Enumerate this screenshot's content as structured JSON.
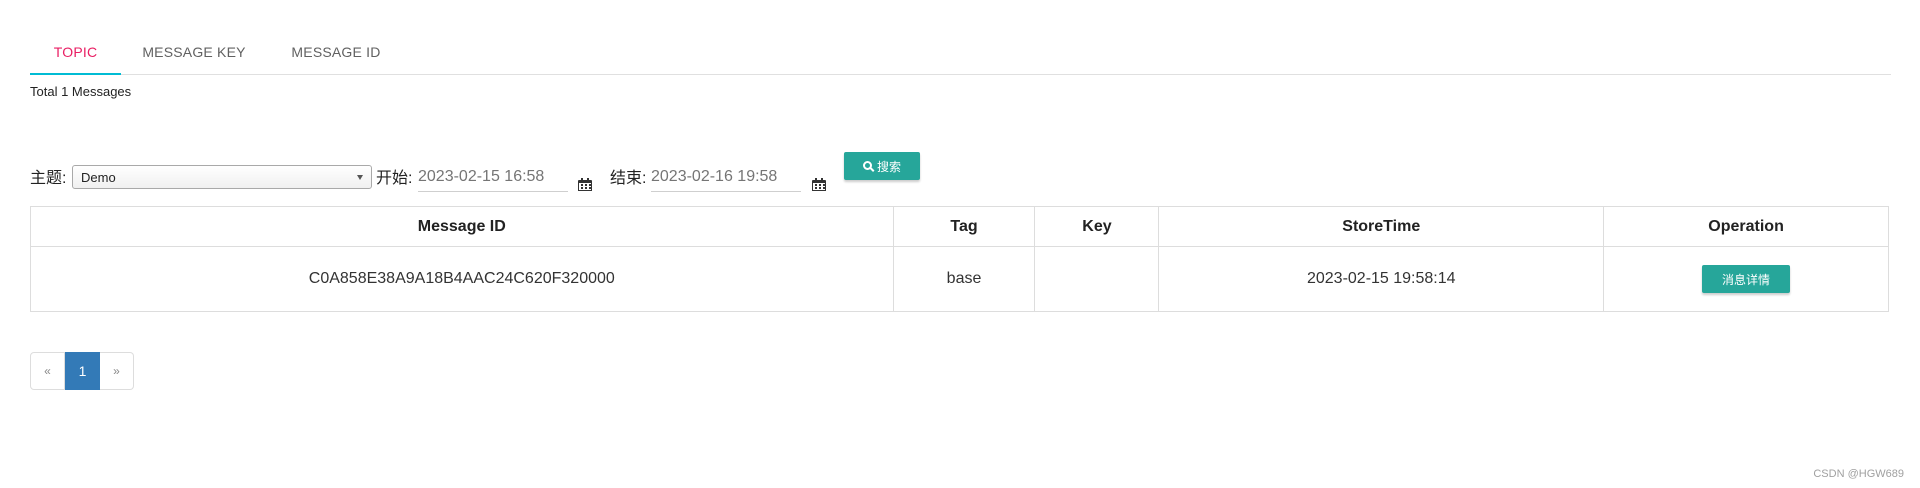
{
  "tabs": [
    {
      "label": "TOPIC",
      "active": true
    },
    {
      "label": "MESSAGE KEY",
      "active": false
    },
    {
      "label": "MESSAGE ID",
      "active": false
    }
  ],
  "summary": {
    "total_text": "Total 1 Messages"
  },
  "search": {
    "topic_label": "主题:",
    "topic_value": "Demo",
    "start_label": "开始:",
    "start_value": "2023-02-15 16:58",
    "end_label": "结束:",
    "end_value": "2023-02-16 19:58",
    "search_button": "搜索"
  },
  "table": {
    "columns": [
      "Message ID",
      "Tag",
      "Key",
      "StoreTime",
      "Operation"
    ],
    "rows": [
      {
        "message_id": "C0A858E38A9A18B4AAC24C620F320000",
        "tag": "base",
        "key": "",
        "store_time": "2023-02-15 19:58:14",
        "operation": "消息详情"
      }
    ]
  },
  "pagination": {
    "prev": "«",
    "current": "1",
    "next": "»"
  },
  "watermark": "CSDN @HGW689",
  "colors": {
    "accent": "#26a69a",
    "active_tab": "#e91e63",
    "tab_indicator": "#00bcd4",
    "page_active": "#337ab7"
  }
}
